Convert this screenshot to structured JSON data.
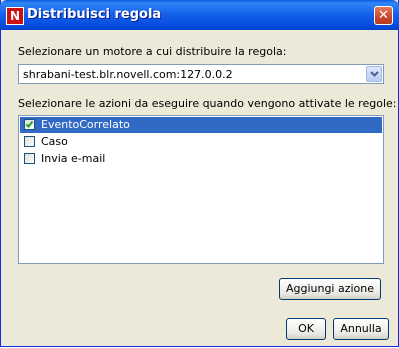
{
  "window": {
    "title": "Distribuisci regola",
    "app_icon_letter": "N",
    "close_glyph": "✕"
  },
  "engine": {
    "label": "Selezionare un motore a cui distribuire la regola:",
    "selected_value": "shrabani-test.blr.novell.com:127.0.0.2"
  },
  "actions": {
    "label": "Selezionare le azioni da eseguire quando vengono attivate le regole:",
    "items": [
      {
        "label": "EventoCorrelato",
        "checked": true,
        "selected": true
      },
      {
        "label": "Caso",
        "checked": false,
        "selected": false
      },
      {
        "label": "Invia e-mail",
        "checked": false,
        "selected": false
      }
    ]
  },
  "buttons": {
    "add_action": "Aggiungi azione",
    "ok": "OK",
    "cancel": "Annulla"
  },
  "colors": {
    "selection": "#316ac5",
    "titlebar": "#0449dc",
    "dialog_bg": "#ece9d8"
  }
}
